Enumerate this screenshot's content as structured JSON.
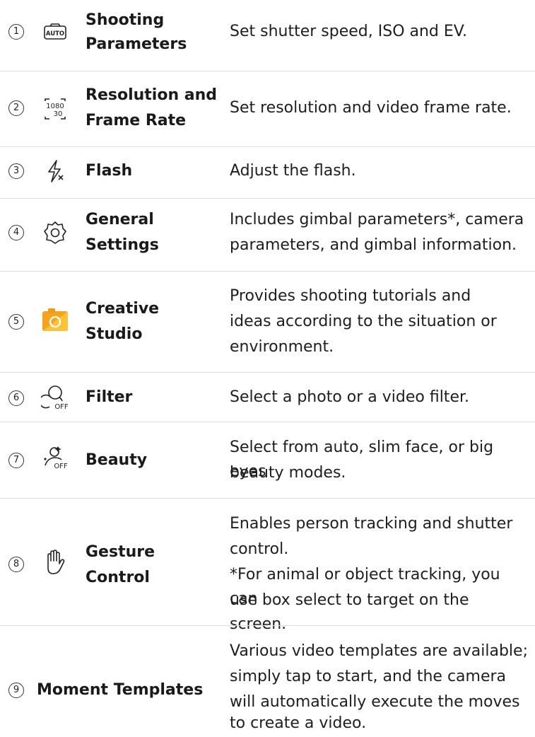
{
  "rows": [
    {
      "num": "1",
      "icon": "auto-mode-icon",
      "name_l1": "Shooting",
      "name_l2": "Parameters",
      "desc": [
        "Set shutter speed, ISO and EV."
      ]
    },
    {
      "num": "2",
      "icon": "resolution-1080-30-icon",
      "name_l1": "Resolution and",
      "name_l2": "Frame Rate",
      "desc": [
        "Set resolution and video frame rate."
      ],
      "icon_text_top": "1080",
      "icon_text_bottom": "30"
    },
    {
      "num": "3",
      "icon": "flash-off-icon",
      "name_l1": "Flash",
      "desc": [
        "Adjust the flash."
      ]
    },
    {
      "num": "4",
      "icon": "gear-icon",
      "name_l1": "General",
      "name_l2": "Settings",
      "desc": [
        "Includes gimbal parameters*, camera",
        "parameters, and gimbal information."
      ]
    },
    {
      "num": "5",
      "icon": "creative-studio-icon",
      "name_l1": "Creative",
      "name_l2": "Studio",
      "desc": [
        "Provides shooting tutorials and",
        "ideas according to the situation or",
        "environment."
      ]
    },
    {
      "num": "6",
      "icon": "filter-off-icon",
      "name_l1": "Filter",
      "desc": [
        "Select a photo or a video filter."
      ],
      "icon_text": "OFF"
    },
    {
      "num": "7",
      "icon": "beauty-off-icon",
      "name_l1": "Beauty",
      "desc": [
        "Select from auto, slim face, or big eyes",
        "beauty modes."
      ],
      "icon_text": "OFF"
    },
    {
      "num": "8",
      "icon": "gesture-hand-icon",
      "name_l1": "Gesture",
      "name_l2": "Control",
      "desc": [
        "Enables person tracking and shutter",
        "control.",
        "*For animal or object tracking, you can",
        "use box select to target on the screen."
      ]
    },
    {
      "num": "9",
      "name_l1": "Moment Templates",
      "desc": [
        "Various video templates are available;",
        "simply tap to start, and the camera",
        "will automatically execute the moves",
        "to create a video."
      ]
    }
  ],
  "icon_auto_text": "AUTO",
  "colors": {
    "accent_orange": "#f7a21b",
    "accent_yellow": "#ffd23f",
    "text": "#1e1e1e",
    "divider": "#dcdcdc"
  }
}
